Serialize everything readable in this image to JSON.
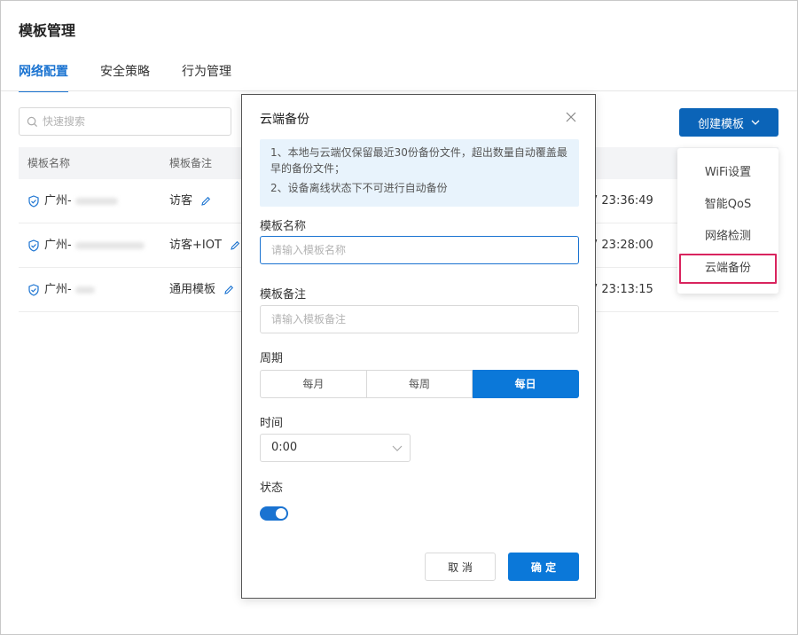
{
  "page": {
    "title": "模板管理"
  },
  "tabs": [
    {
      "label": "网络配置",
      "active": true
    },
    {
      "label": "安全策略",
      "active": false
    },
    {
      "label": "行为管理",
      "active": false
    }
  ],
  "search": {
    "placeholder": "快速搜索",
    "icon": "search-icon"
  },
  "create_button": {
    "label": "创建模板",
    "icon": "chevron-down-icon"
  },
  "dropdown": {
    "items": [
      {
        "label": "WiFi设置"
      },
      {
        "label": "智能QoS"
      },
      {
        "label": "网络检测"
      },
      {
        "label": "云端备份"
      }
    ]
  },
  "table": {
    "headers": {
      "name": "模板名称",
      "note": "模板备注"
    },
    "rows": [
      {
        "name_prefix": "广州-",
        "note": "访客",
        "time_fragment": "7 23:36:49"
      },
      {
        "name_prefix": "广州-",
        "note": "访客+IOT",
        "time_fragment": "7 23:28:00"
      },
      {
        "name_prefix": "广州-",
        "note": "通用模板",
        "time_fragment": "7 23:13:15"
      }
    ]
  },
  "modal": {
    "title": "云端备份",
    "notice": [
      "1、本地与云端仅保留最近30份备份文件，超出数量自动覆盖最早的备份文件；",
      "2、设备离线状态下不可进行自动备份"
    ],
    "name_label": "模板名称",
    "name_placeholder": "请输入模板名称",
    "note_label": "模板备注",
    "note_placeholder": "请输入模板备注",
    "period_label": "周期",
    "period_options": [
      {
        "label": "每月",
        "active": false
      },
      {
        "label": "每周",
        "active": false
      },
      {
        "label": "每日",
        "active": true
      }
    ],
    "time_label": "时间",
    "time_value": "0:00",
    "status_label": "状态",
    "status_enabled": true,
    "cancel_label": "取 消",
    "ok_label": "确 定"
  },
  "colors": {
    "primary": "#0b64b8",
    "accent": "#1a73d1",
    "highlight_border": "#d9245e",
    "notice_bg": "#e8f3fc"
  }
}
